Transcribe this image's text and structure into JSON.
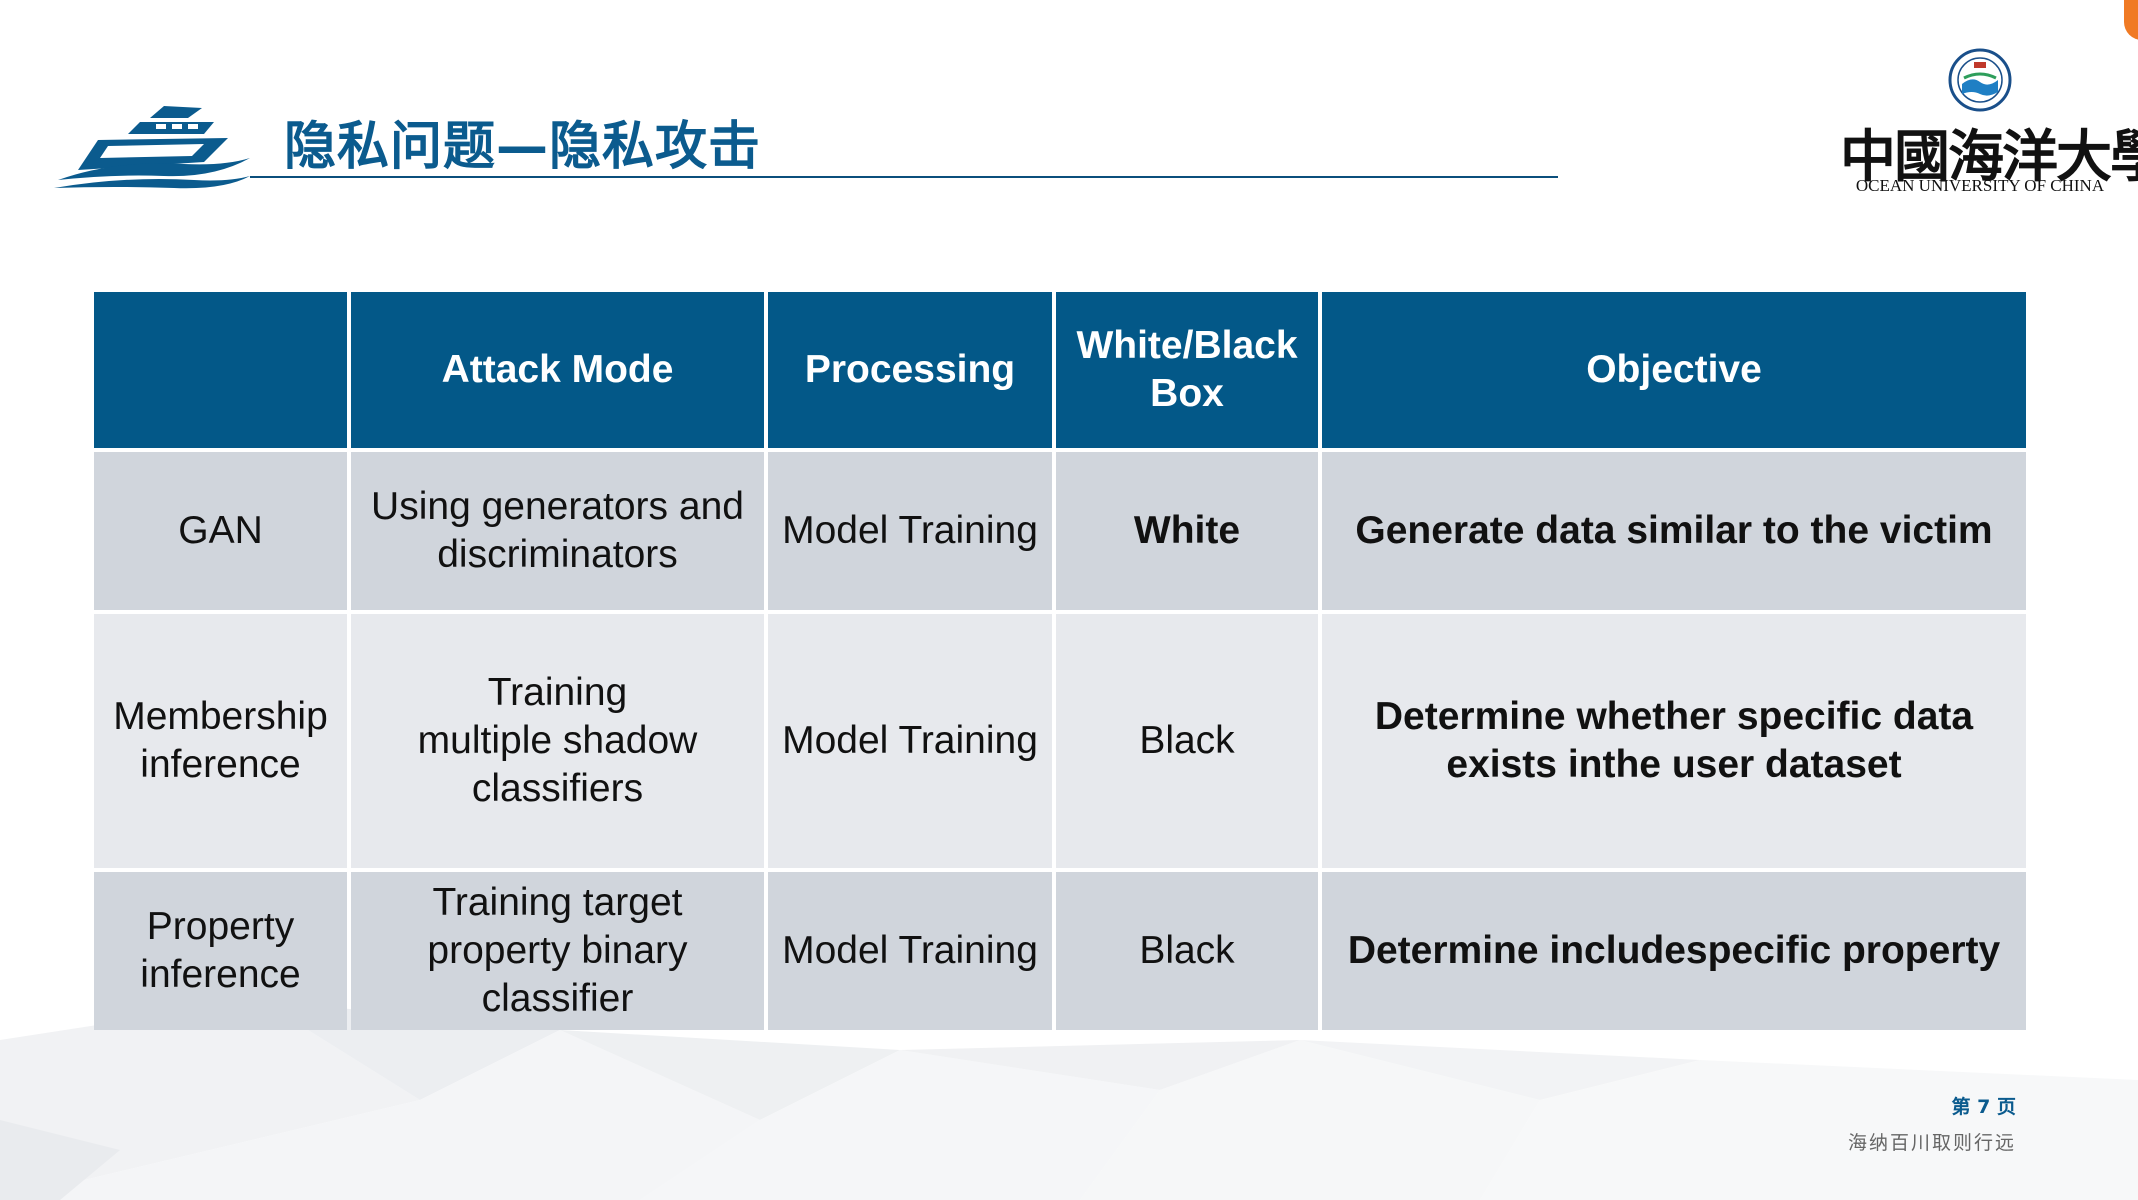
{
  "slide": {
    "title": "隐私问题—隐私攻击",
    "university": {
      "name_cn": "中國海洋大學",
      "name_en": "OCEAN UNIVERSITY OF CHINA"
    }
  },
  "table": {
    "headers": [
      "",
      "Attack Mode",
      "Processing",
      "White/Black Box",
      "Objective"
    ],
    "rows": [
      {
        "name": "GAN",
        "attack_mode": "Using generators and discriminators",
        "processing": "Model Training",
        "box": "White",
        "objective": "Generate data similar to the victim"
      },
      {
        "name": "Membership inference",
        "attack_mode": "Training multiple shadow classifiers",
        "processing": "Model Training",
        "box": "Black",
        "objective": "Determine whether specific data exists inthe user dataset"
      },
      {
        "name": "Property inference",
        "attack_mode": "Training target property binary classifier",
        "processing": "Model Training",
        "box": "Black",
        "objective": "Determine includespecific property"
      }
    ]
  },
  "footer": {
    "page": "第 7 页",
    "motto": "海纳百川取则行远"
  },
  "colors": {
    "header_bg": "#035888",
    "row_dark": "#d0d5dc",
    "row_light": "#e7e9ed",
    "title": "#0b5b8e",
    "accent_dot": "#f07a24"
  },
  "icons": {
    "ship_logo": "ship-icon",
    "university_seal": "seal-icon"
  }
}
